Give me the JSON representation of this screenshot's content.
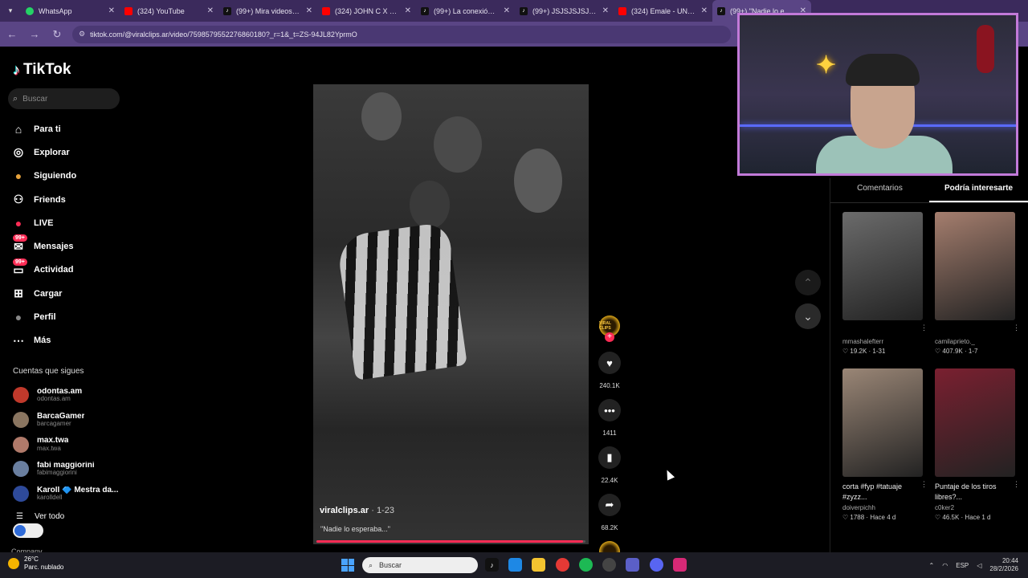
{
  "browser": {
    "tabs": [
      {
        "title": "WhatsApp",
        "icon": "whatsapp-icon"
      },
      {
        "title": "(324) YouTube",
        "icon": "youtube-icon"
      },
      {
        "title": "(99+) Mira videos pop",
        "icon": "tiktok-icon"
      },
      {
        "title": "(324) JOHN C X EZEQ",
        "icon": "youtube-icon"
      },
      {
        "title": "(99+) La conexión dir",
        "icon": "tiktok-icon"
      },
      {
        "title": "(99+) JSJSJSJSJSJSJS",
        "icon": "tiktok-icon"
      },
      {
        "title": "(324) Emale - UNAS P",
        "icon": "youtube-icon"
      },
      {
        "title": "(99+) \"Nadie lo e",
        "icon": "tiktok-icon",
        "active": true
      }
    ],
    "url": "tiktok.com/@viralclips.ar/video/7598579552276860180?_r=1&_t=ZS-94JL82YprmO"
  },
  "sidebar": {
    "brand": "TikTok",
    "search_placeholder": "Buscar",
    "nav": [
      {
        "label": "Para ti",
        "icon": "home-icon"
      },
      {
        "label": "Explorar",
        "icon": "compass-icon"
      },
      {
        "label": "Siguiendo",
        "icon": "avatar-icon"
      },
      {
        "label": "Friends",
        "icon": "friends-icon"
      },
      {
        "label": "LIVE",
        "icon": "live-icon"
      },
      {
        "label": "Mensajes",
        "icon": "messages-icon",
        "badge": "99+"
      },
      {
        "label": "Actividad",
        "icon": "activity-icon",
        "badge": "99+"
      },
      {
        "label": "Cargar",
        "icon": "upload-icon"
      },
      {
        "label": "Perfil",
        "icon": "profile-icon"
      },
      {
        "label": "Más",
        "icon": "more-icon"
      }
    ],
    "following_title": "Cuentas que sigues",
    "following": [
      {
        "name": "odontas.am",
        "handle": "odontas.am",
        "color": "#c0392b"
      },
      {
        "name": "BarcaGamer",
        "handle": "barcagamer",
        "color": "#8a7560"
      },
      {
        "name": "max.twa",
        "handle": "max.twa",
        "color": "#b07a6a"
      },
      {
        "name": "fabi maggiorini",
        "handle": "fabimaggiorini",
        "color": "#6a7fa0"
      },
      {
        "name": "Karoll 🔷 Mestra da...",
        "handle": "karolldell",
        "color": "#2e4a9a"
      }
    ],
    "see_all": "Ver todo",
    "company": "Company"
  },
  "video": {
    "author": "viralclips.ar",
    "date": "· 1-23",
    "caption": "\"Nadie lo esperaba...\"",
    "progress": 0.99,
    "likes": "240.1K",
    "comments": "1411",
    "saves": "22.4K",
    "shares": "68.2K",
    "author_badge": "VIRAL CLIPS"
  },
  "right": {
    "tabs": [
      "Comentarios",
      "Podría interesarte"
    ],
    "cards": [
      {
        "title": "",
        "user": "mmashalefterr",
        "likes": "19.2K",
        "date": "1-31",
        "color": "#6b6b6b"
      },
      {
        "title": "",
        "user": "camilaprieto._",
        "likes": "407.9K",
        "date": "1-7",
        "color": "#a57e6e"
      },
      {
        "title": "corta #fyp #tatuaje #zyzz...",
        "user": "doiverpichh",
        "likes": "1788",
        "date": "Hace 4 d",
        "color": "#9a8676"
      },
      {
        "title": "Puntaje de los tiros libres?...",
        "user": "c0ker2",
        "likes": "46.5K",
        "date": "Hace 1 d",
        "color": "#7a2030"
      }
    ]
  },
  "taskbar": {
    "temp": "26°C",
    "weather": "Parc. nublado",
    "search_placeholder": "Buscar",
    "lang": "ESP",
    "time": "20:44",
    "date": "28/2/2026"
  }
}
